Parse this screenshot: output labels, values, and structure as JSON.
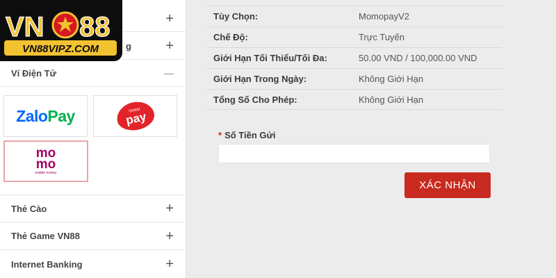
{
  "brand": {
    "logo_text": "VN88",
    "logo_domain": "VN88VIPZ.COM",
    "colors": {
      "gold": "#f2c230",
      "red": "#d71920",
      "dark": "#0d0d0d"
    }
  },
  "sidebar": {
    "rows_top": [
      {
        "label": "",
        "sign": "+"
      },
      {
        "label": "g",
        "sign": "+"
      }
    ],
    "wallet_section": {
      "label": "Ví Điện Tử",
      "sign": "—"
    },
    "wallets": [
      {
        "name": "ZaloPay",
        "logo_a": "Zalo",
        "logo_b": "Pay",
        "selected": false
      },
      {
        "name": "ViettelPay",
        "logo_a": "Viettel",
        "logo_b": "pay",
        "selected": false
      },
      {
        "name": "MoMo",
        "logo_a": "mo",
        "logo_b": "mo",
        "logo_c": "mobile money",
        "selected": true
      }
    ],
    "rows_bottom": [
      {
        "label": "Thẻ Cào",
        "sign": "+"
      },
      {
        "label": "Thẻ Game VN88",
        "sign": "+"
      },
      {
        "label": "Internet Banking",
        "sign": "+"
      }
    ]
  },
  "info": [
    {
      "label": "Tùy Chọn:",
      "value": "MomopayV2"
    },
    {
      "label": "Chế Độ:",
      "value": "Trực Tuyến"
    },
    {
      "label": "Giới Hạn Tối Thiểu/Tối Đa:",
      "value": "50.00 VND / 100,000.00 VND"
    },
    {
      "label": "Giới Hạn Trong Ngày:",
      "value": "Không Giới Hạn"
    },
    {
      "label": "Tổng Số Cho Phép:",
      "value": "Không Giới Hạn"
    }
  ],
  "form": {
    "required_mark": "*",
    "amount_label": "Số Tiền Gửi",
    "amount_value": "",
    "confirm_label": "XÁC NHẬN"
  },
  "colors": {
    "accent": "#c92a20",
    "zalo_blue": "#0068ff",
    "zalo_green": "#00b14f",
    "momo_purple": "#a50064"
  }
}
